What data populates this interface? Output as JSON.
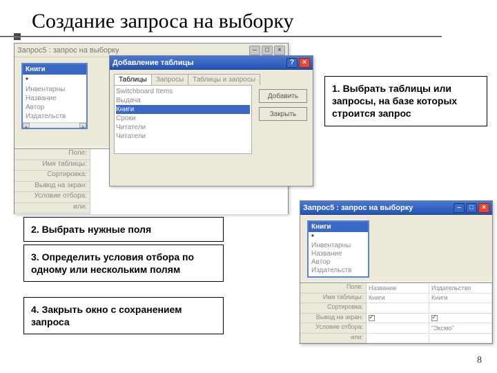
{
  "slide": {
    "title": "Создание запроса на выборку",
    "number": "8"
  },
  "callouts": {
    "c1": "1.  Выбрать таблицы или запросы, на базе которых строится запрос",
    "c2": "2.  Выбрать нужные поля",
    "c3": "3.  Определить условия отбора по одному или нескольким полям",
    "c4": "4.  Закрыть окно с сохранением запроса"
  },
  "win_left": {
    "title": "Запрос5 : запрос на выборку",
    "table_title": "Книги",
    "fields": [
      "*",
      "Инвентарны",
      "Название",
      "Автор",
      "Издательств"
    ],
    "grid_rows": [
      "Поле:",
      "Имя таблицы:",
      "Сортировка:",
      "Вывод на экран:",
      "Условие отбора:",
      "или:"
    ]
  },
  "dialog": {
    "title": "Добавление таблицы",
    "tabs": [
      "Таблицы",
      "Запросы",
      "Таблицы и запросы"
    ],
    "items": [
      "Switchboard Items",
      "Выдача",
      "Книги",
      "Сроки",
      "Читатели",
      "Читатели"
    ],
    "selected": "Книги",
    "btn_add": "Добавить",
    "btn_close": "Закрыть"
  },
  "win_right": {
    "title": "Запрос5 : запрос на выборку",
    "table_title": "Книги",
    "fields": [
      "*",
      "Инвентарны",
      "Название",
      "Автор",
      "Издательств"
    ],
    "grid_rows": [
      "Поле:",
      "Имя таблицы:",
      "Сортировка:",
      "Вывод на экран:",
      "Условие отбора:",
      "или:"
    ],
    "col1": {
      "field": "Название",
      "table": "Книги",
      "sort": "",
      "show": true,
      "cond": ""
    },
    "col2": {
      "field": "Издательство",
      "table": "Книги",
      "sort": "",
      "show": true,
      "cond": "\"Эксмо\""
    }
  }
}
